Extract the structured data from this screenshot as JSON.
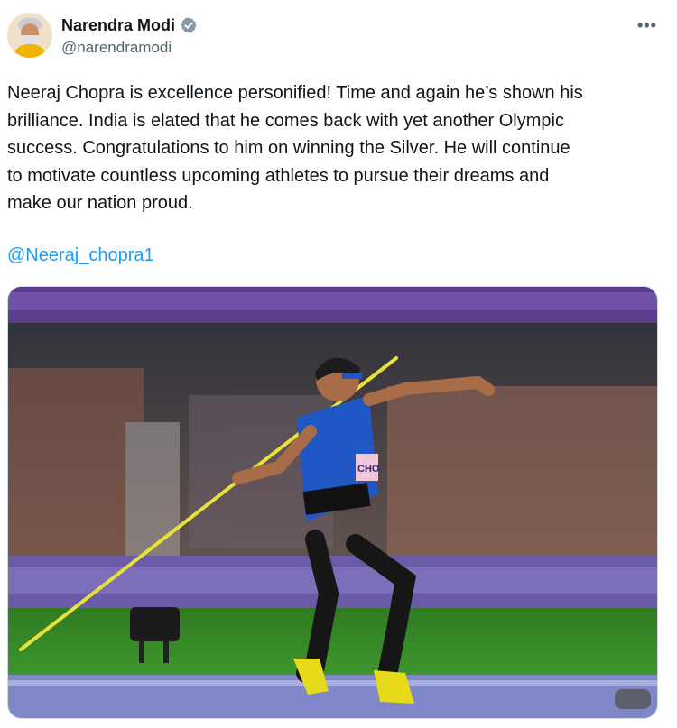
{
  "author": {
    "display_name": "Narendra Modi",
    "handle": "@narendramodi",
    "verified": true,
    "avatar_icon": "profile-photo"
  },
  "tweet": {
    "text_lines": [
      "Neeraj Chopra is excellence personified! Time and again he’s shown his",
      "brilliance. India is elated that he comes back with yet another Olympic",
      "success. Congratulations to him on winning the Silver. He will continue",
      "to motivate countless upcoming athletes to pursue their dreams and",
      "make our nation proud."
    ],
    "mention": "@Neeraj_chopra1"
  },
  "media": {
    "alt": "Javelin thrower in blue kit mid-throw in a stadium",
    "bib_text": "CHO"
  },
  "icons": {
    "verified": "verified-badge-icon",
    "more": "more-options-icon"
  },
  "colors": {
    "link": "#1d9bf0",
    "verified": "#829aab",
    "text": "#0f1419",
    "muted": "#536471"
  }
}
